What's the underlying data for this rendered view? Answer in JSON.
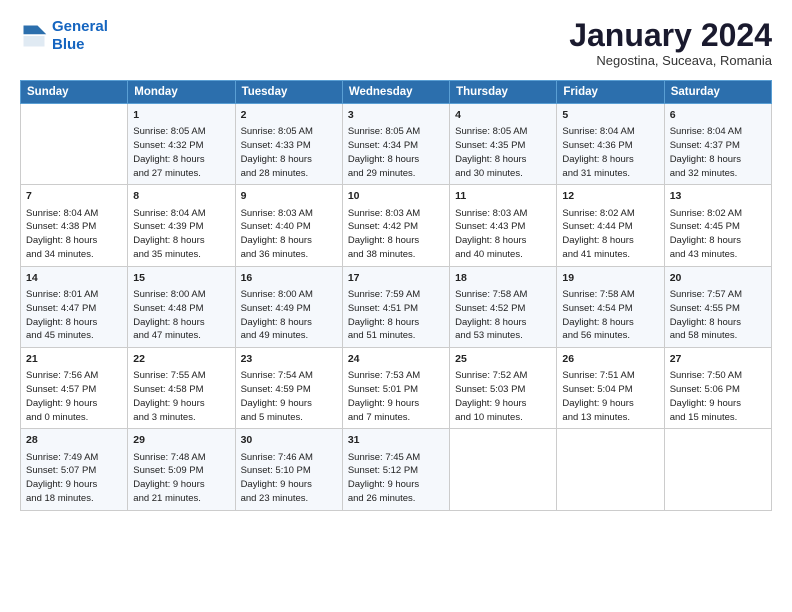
{
  "header": {
    "logo_line1": "General",
    "logo_line2": "Blue",
    "month_title": "January 2024",
    "location": "Negostina, Suceava, Romania"
  },
  "days_of_week": [
    "Sunday",
    "Monday",
    "Tuesday",
    "Wednesday",
    "Thursday",
    "Friday",
    "Saturday"
  ],
  "weeks": [
    [
      {
        "day": "",
        "content": ""
      },
      {
        "day": "1",
        "content": "Sunrise: 8:05 AM\nSunset: 4:32 PM\nDaylight: 8 hours\nand 27 minutes."
      },
      {
        "day": "2",
        "content": "Sunrise: 8:05 AM\nSunset: 4:33 PM\nDaylight: 8 hours\nand 28 minutes."
      },
      {
        "day": "3",
        "content": "Sunrise: 8:05 AM\nSunset: 4:34 PM\nDaylight: 8 hours\nand 29 minutes."
      },
      {
        "day": "4",
        "content": "Sunrise: 8:05 AM\nSunset: 4:35 PM\nDaylight: 8 hours\nand 30 minutes."
      },
      {
        "day": "5",
        "content": "Sunrise: 8:04 AM\nSunset: 4:36 PM\nDaylight: 8 hours\nand 31 minutes."
      },
      {
        "day": "6",
        "content": "Sunrise: 8:04 AM\nSunset: 4:37 PM\nDaylight: 8 hours\nand 32 minutes."
      }
    ],
    [
      {
        "day": "7",
        "content": "Sunrise: 8:04 AM\nSunset: 4:38 PM\nDaylight: 8 hours\nand 34 minutes."
      },
      {
        "day": "8",
        "content": "Sunrise: 8:04 AM\nSunset: 4:39 PM\nDaylight: 8 hours\nand 35 minutes."
      },
      {
        "day": "9",
        "content": "Sunrise: 8:03 AM\nSunset: 4:40 PM\nDaylight: 8 hours\nand 36 minutes."
      },
      {
        "day": "10",
        "content": "Sunrise: 8:03 AM\nSunset: 4:42 PM\nDaylight: 8 hours\nand 38 minutes."
      },
      {
        "day": "11",
        "content": "Sunrise: 8:03 AM\nSunset: 4:43 PM\nDaylight: 8 hours\nand 40 minutes."
      },
      {
        "day": "12",
        "content": "Sunrise: 8:02 AM\nSunset: 4:44 PM\nDaylight: 8 hours\nand 41 minutes."
      },
      {
        "day": "13",
        "content": "Sunrise: 8:02 AM\nSunset: 4:45 PM\nDaylight: 8 hours\nand 43 minutes."
      }
    ],
    [
      {
        "day": "14",
        "content": "Sunrise: 8:01 AM\nSunset: 4:47 PM\nDaylight: 8 hours\nand 45 minutes."
      },
      {
        "day": "15",
        "content": "Sunrise: 8:00 AM\nSunset: 4:48 PM\nDaylight: 8 hours\nand 47 minutes."
      },
      {
        "day": "16",
        "content": "Sunrise: 8:00 AM\nSunset: 4:49 PM\nDaylight: 8 hours\nand 49 minutes."
      },
      {
        "day": "17",
        "content": "Sunrise: 7:59 AM\nSunset: 4:51 PM\nDaylight: 8 hours\nand 51 minutes."
      },
      {
        "day": "18",
        "content": "Sunrise: 7:58 AM\nSunset: 4:52 PM\nDaylight: 8 hours\nand 53 minutes."
      },
      {
        "day": "19",
        "content": "Sunrise: 7:58 AM\nSunset: 4:54 PM\nDaylight: 8 hours\nand 56 minutes."
      },
      {
        "day": "20",
        "content": "Sunrise: 7:57 AM\nSunset: 4:55 PM\nDaylight: 8 hours\nand 58 minutes."
      }
    ],
    [
      {
        "day": "21",
        "content": "Sunrise: 7:56 AM\nSunset: 4:57 PM\nDaylight: 9 hours\nand 0 minutes."
      },
      {
        "day": "22",
        "content": "Sunrise: 7:55 AM\nSunset: 4:58 PM\nDaylight: 9 hours\nand 3 minutes."
      },
      {
        "day": "23",
        "content": "Sunrise: 7:54 AM\nSunset: 4:59 PM\nDaylight: 9 hours\nand 5 minutes."
      },
      {
        "day": "24",
        "content": "Sunrise: 7:53 AM\nSunset: 5:01 PM\nDaylight: 9 hours\nand 7 minutes."
      },
      {
        "day": "25",
        "content": "Sunrise: 7:52 AM\nSunset: 5:03 PM\nDaylight: 9 hours\nand 10 minutes."
      },
      {
        "day": "26",
        "content": "Sunrise: 7:51 AM\nSunset: 5:04 PM\nDaylight: 9 hours\nand 13 minutes."
      },
      {
        "day": "27",
        "content": "Sunrise: 7:50 AM\nSunset: 5:06 PM\nDaylight: 9 hours\nand 15 minutes."
      }
    ],
    [
      {
        "day": "28",
        "content": "Sunrise: 7:49 AM\nSunset: 5:07 PM\nDaylight: 9 hours\nand 18 minutes."
      },
      {
        "day": "29",
        "content": "Sunrise: 7:48 AM\nSunset: 5:09 PM\nDaylight: 9 hours\nand 21 minutes."
      },
      {
        "day": "30",
        "content": "Sunrise: 7:46 AM\nSunset: 5:10 PM\nDaylight: 9 hours\nand 23 minutes."
      },
      {
        "day": "31",
        "content": "Sunrise: 7:45 AM\nSunset: 5:12 PM\nDaylight: 9 hours\nand 26 minutes."
      },
      {
        "day": "",
        "content": ""
      },
      {
        "day": "",
        "content": ""
      },
      {
        "day": "",
        "content": ""
      }
    ]
  ]
}
